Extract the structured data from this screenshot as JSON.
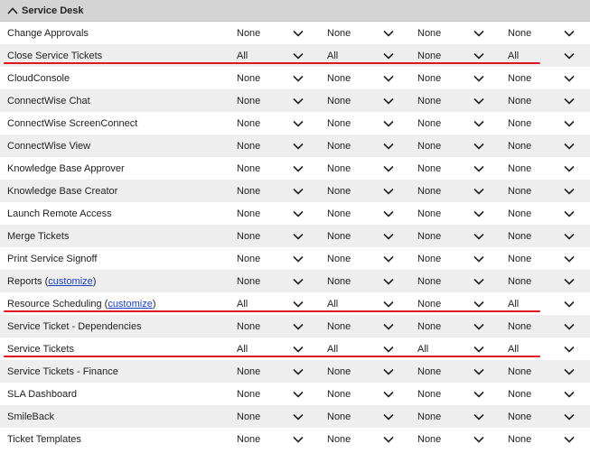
{
  "section": {
    "title": "Service Desk"
  },
  "rows": [
    {
      "name": "Change Approvals",
      "values": [
        "None",
        "None",
        "None",
        "None"
      ]
    },
    {
      "name": "Close Service Tickets",
      "values": [
        "All",
        "All",
        "None",
        "All"
      ],
      "highlight": true
    },
    {
      "name": "CloudConsole",
      "values": [
        "None",
        "None",
        "None",
        "None"
      ]
    },
    {
      "name": "ConnectWise Chat",
      "values": [
        "None",
        "None",
        "None",
        "None"
      ]
    },
    {
      "name": "ConnectWise ScreenConnect",
      "values": [
        "None",
        "None",
        "None",
        "None"
      ]
    },
    {
      "name": "ConnectWise View",
      "values": [
        "None",
        "None",
        "None",
        "None"
      ]
    },
    {
      "name": "Knowledge Base Approver",
      "values": [
        "None",
        "None",
        "None",
        "None"
      ]
    },
    {
      "name": "Knowledge Base Creator",
      "values": [
        "None",
        "None",
        "None",
        "None"
      ]
    },
    {
      "name": "Launch Remote Access",
      "values": [
        "None",
        "None",
        "None",
        "None"
      ]
    },
    {
      "name": "Merge Tickets",
      "values": [
        "None",
        "None",
        "None",
        "None"
      ]
    },
    {
      "name": "Print Service Signoff",
      "values": [
        "None",
        "None",
        "None",
        "None"
      ]
    },
    {
      "name": "Reports",
      "link": "customize",
      "values": [
        "None",
        "None",
        "None",
        "None"
      ]
    },
    {
      "name": "Resource Scheduling",
      "link": "customize",
      "values": [
        "All",
        "All",
        "None",
        "All"
      ],
      "highlight": true
    },
    {
      "name": "Service Ticket - Dependencies",
      "values": [
        "None",
        "None",
        "None",
        "None"
      ]
    },
    {
      "name": "Service Tickets",
      "values": [
        "All",
        "All",
        "All",
        "All"
      ],
      "highlight": true
    },
    {
      "name": "Service Tickets - Finance",
      "values": [
        "None",
        "None",
        "None",
        "None"
      ]
    },
    {
      "name": "SLA Dashboard",
      "values": [
        "None",
        "None",
        "None",
        "None"
      ]
    },
    {
      "name": "SmileBack",
      "values": [
        "None",
        "None",
        "None",
        "None"
      ]
    },
    {
      "name": "Ticket Templates",
      "values": [
        "None",
        "None",
        "None",
        "None"
      ]
    }
  ],
  "colors": {
    "highlight": "#e0141e",
    "alt_row": "#eeeeee",
    "header": "#d4d4d4",
    "link": "#1a3fbf"
  },
  "icons": {
    "collapse": "chevron-up-icon",
    "dropdown": "chevron-down-icon"
  }
}
